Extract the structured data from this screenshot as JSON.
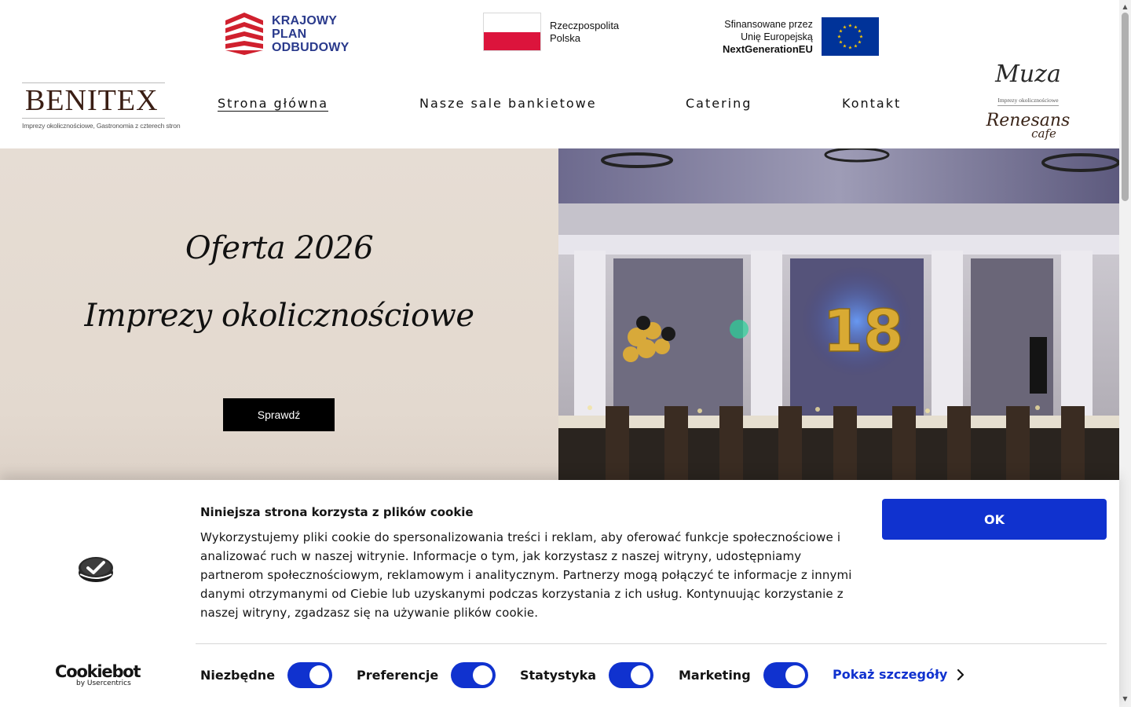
{
  "funding": {
    "kpo_lines": [
      "KRAJOWY",
      "PLAN",
      "ODBUDOWY"
    ],
    "pl_lines": [
      "Rzeczpospolita",
      "Polska"
    ],
    "eu_lines": [
      "Sfinansowane przez",
      "Unię Europejską",
      "NextGenerationEU"
    ]
  },
  "brand": {
    "name": "BENITEX",
    "tagline": "Imprezy okolicznościowe, Gastronomia z czterech stron"
  },
  "nav": {
    "items": [
      {
        "label": "Strona główna",
        "active": true
      },
      {
        "label": "Nasze sale bankietowe",
        "active": false
      },
      {
        "label": "Catering",
        "active": false
      },
      {
        "label": "Kontakt",
        "active": false
      }
    ]
  },
  "partners": {
    "muza": "Muza",
    "muza_sub": "Imprezy okolicznościowe",
    "renesans": "Renesans",
    "renesans_sub": "cafe"
  },
  "hero": {
    "line1": "Oferta 2026",
    "line2": "Imprezy okolicznościowe",
    "cta": "Sprawdź",
    "photo_number": "18"
  },
  "cookie": {
    "title": "Niniejsza strona korzysta z plików cookie",
    "body": "Wykorzystujemy pliki cookie do spersonalizowania treści i reklam, aby oferować funkcje społecznościowe i analizować ruch w naszej witrynie. Informacje o tym, jak korzystasz z naszej witryny, udostępniamy partnerom społecznościowym, reklamowym i analitycznym. Partnerzy mogą połączyć te informacje z innymi danymi otrzymanymi od Ciebie lub uzyskanymi podczas korzystania z ich usług. Kontynuując korzystanie z naszej witryny, zgadzasz się na używanie plików cookie.",
    "ok": "OK",
    "cookiebot_name": "Cookiebot",
    "cookiebot_by": "by Usercentrics",
    "toggles": [
      {
        "label": "Niezbędne",
        "checked": true
      },
      {
        "label": "Preferencje",
        "checked": true
      },
      {
        "label": "Statystyka",
        "checked": true
      },
      {
        "label": "Marketing",
        "checked": true
      }
    ],
    "details": "Pokaż szczegóły"
  },
  "colors": {
    "accent": "#1032cf",
    "hero_bg": "#e6ddd4",
    "kpo_blue": "#2a3a8c",
    "kpo_red": "#d0202e",
    "pl_red": "#dc143c",
    "eu_blue": "#003399",
    "eu_star": "#ffcc00"
  }
}
